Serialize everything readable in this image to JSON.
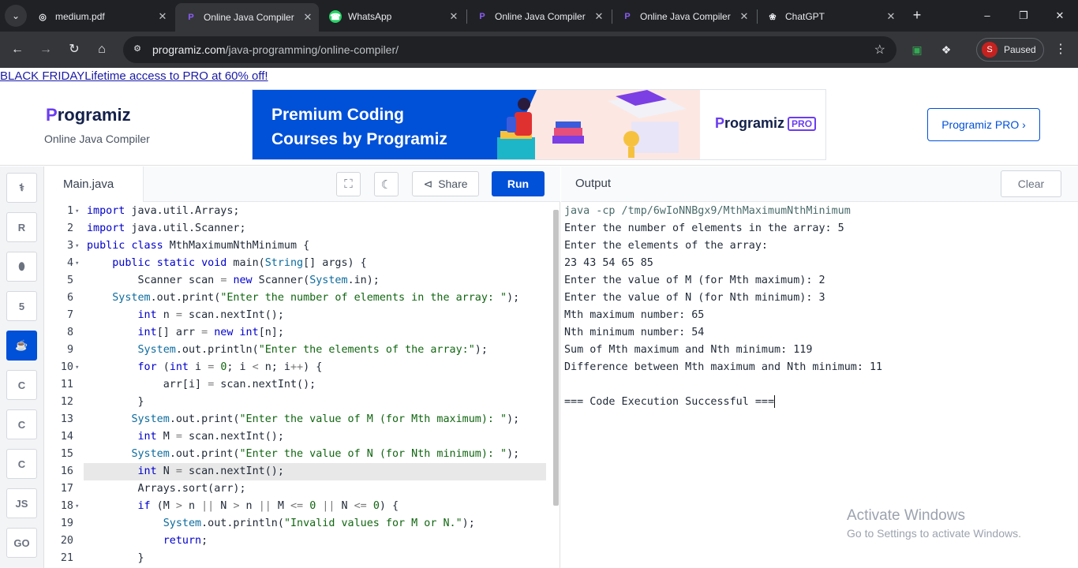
{
  "browser": {
    "tabs": [
      {
        "title": "medium.pdf",
        "icon": "globe-icon",
        "active": false
      },
      {
        "title": "Online Java Compiler",
        "icon": "programiz-icon",
        "active": true
      },
      {
        "title": "WhatsApp",
        "icon": "whatsapp-icon",
        "active": false
      },
      {
        "title": "Online Java Compiler",
        "icon": "programiz-icon",
        "active": false
      },
      {
        "title": "Online Java Compiler",
        "icon": "programiz-icon",
        "active": false
      },
      {
        "title": "ChatGPT",
        "icon": "chatgpt-icon",
        "active": false
      }
    ],
    "url_domain": "programiz.com",
    "url_path": "/java-programming/online-compiler/",
    "profile_initial": "S",
    "profile_status": "Paused"
  },
  "promo": {
    "text": "BLACK FRIDAYLifetime access to PRO at 60% off!"
  },
  "header": {
    "logo_initial": "P",
    "logo_rest": "rogramiz",
    "subtitle": "Online Java Compiler",
    "banner_title_line1": "Premium Coding",
    "banner_title_line2": "Courses by Programiz",
    "banner_logo_initial": "P",
    "banner_logo_rest": "rogramiz",
    "banner_pro": "PRO",
    "pro_button": "Programiz PRO ›"
  },
  "sidebar": {
    "languages": [
      {
        "name": "python-icon",
        "glyph": "⚕",
        "active": false
      },
      {
        "name": "r-icon",
        "glyph": "R",
        "active": false
      },
      {
        "name": "sql-icon",
        "glyph": "⬮",
        "active": false
      },
      {
        "name": "html-icon",
        "glyph": "5",
        "active": false
      },
      {
        "name": "java-icon",
        "glyph": "☕",
        "active": true
      },
      {
        "name": "c-icon",
        "glyph": "C",
        "active": false
      },
      {
        "name": "csharp-icon",
        "glyph": "C",
        "active": false
      },
      {
        "name": "cpp-icon",
        "glyph": "C",
        "active": false
      },
      {
        "name": "js-icon",
        "glyph": "JS",
        "active": false
      },
      {
        "name": "go-icon",
        "glyph": "GO",
        "active": false
      }
    ]
  },
  "editor": {
    "file_name": "Main.java",
    "share_label": "Share",
    "run_label": "Run",
    "highlighted_line": 16,
    "lines": [
      {
        "n": "1",
        "fold": true,
        "html": "<span class='kw'>import</span> java.util.Arrays;"
      },
      {
        "n": "2",
        "fold": false,
        "html": "<span class='kw'>import</span> java.util.Scanner;"
      },
      {
        "n": "3",
        "fold": true,
        "html": "<span class='kw'>public</span> <span class='kw'>class</span> MthMaximumNthMinimum {"
      },
      {
        "n": "4",
        "fold": true,
        "html": "    <span class='kw'>public</span> <span class='kw'>static</span> <span class='kw'>void</span> main(<span class='cls'>String</span>[] args) {"
      },
      {
        "n": "5",
        "fold": false,
        "html": "        Scanner scan <span class='op'>=</span> <span class='kw'>new</span> Scanner(<span class='cls'>System</span>.in);"
      },
      {
        "n": "6",
        "fold": false,
        "html": "    <span class='cls'>System</span>.out.print(<span class='str'>\"Enter the number of elements in the array: \"</span>);"
      },
      {
        "n": "7",
        "fold": false,
        "html": "        <span class='kw'>int</span> n <span class='op'>=</span> scan.nextInt();"
      },
      {
        "n": "8",
        "fold": false,
        "html": "        <span class='kw'>int</span>[] arr <span class='op'>=</span> <span class='kw'>new</span> <span class='kw'>int</span>[n];"
      },
      {
        "n": "9",
        "fold": false,
        "html": "        <span class='cls'>System</span>.out.println(<span class='str'>\"Enter the elements of the array:\"</span>);"
      },
      {
        "n": "10",
        "fold": true,
        "html": "        <span class='kw'>for</span> (<span class='kw'>int</span> i <span class='op'>=</span> <span class='num'>0</span>; i <span class='op'>&lt;</span> n; i<span class='op'>++</span>) {"
      },
      {
        "n": "11",
        "fold": false,
        "html": "            arr[i] <span class='op'>=</span> scan.nextInt();"
      },
      {
        "n": "12",
        "fold": false,
        "html": "        }"
      },
      {
        "n": "13",
        "fold": false,
        "html": "       <span class='cls'>System</span>.out.print(<span class='str'>\"Enter the value of M (for Mth maximum): \"</span>);"
      },
      {
        "n": "14",
        "fold": false,
        "html": "        <span class='kw'>int</span> M <span class='op'>=</span> scan.nextInt();"
      },
      {
        "n": "15",
        "fold": false,
        "html": "       <span class='cls'>System</span>.out.print(<span class='str'>\"Enter the value of N (for Nth minimum): \"</span>);"
      },
      {
        "n": "16",
        "fold": false,
        "html": "        <span class='kw'>int</span> N <span class='op'>=</span> scan.nextInt();"
      },
      {
        "n": "17",
        "fold": false,
        "html": "        Arrays.sort(arr);"
      },
      {
        "n": "18",
        "fold": true,
        "html": "        <span class='kw'>if</span> (M <span class='op'>&gt;</span> n <span class='op'>||</span> N <span class='op'>&gt;</span> n <span class='op'>||</span> M <span class='op'>&lt;=</span> <span class='num'>0</span> <span class='op'>||</span> N <span class='op'>&lt;=</span> <span class='num'>0</span>) {"
      },
      {
        "n": "19",
        "fold": false,
        "html": "            <span class='cls'>System</span>.out.println(<span class='str'>\"Invalid values for M or N.\"</span>);"
      },
      {
        "n": "20",
        "fold": false,
        "html": "            <span class='kw'>return</span>;"
      },
      {
        "n": "21",
        "fold": false,
        "html": "        }"
      }
    ]
  },
  "output": {
    "title": "Output",
    "clear_label": "Clear",
    "lines": [
      "java -cp /tmp/6wIoNNBgx9/MthMaximumNthMinimum",
      "Enter the number of elements in the array: 5",
      "Enter the elements of the array:",
      "23 43 54 65 85",
      "Enter the value of M (for Mth maximum): 2",
      "Enter the value of N (for Nth minimum): 3",
      "Mth maximum number: 65",
      "Nth minimum number: 54",
      "Sum of Mth maximum and Nth minimum: 119",
      "Difference between Mth maximum and Nth minimum: 11",
      "",
      "=== Code Execution Successful ==="
    ]
  },
  "watermark": {
    "line1": "Activate Windows",
    "line2": "Go to Settings to activate Windows."
  }
}
